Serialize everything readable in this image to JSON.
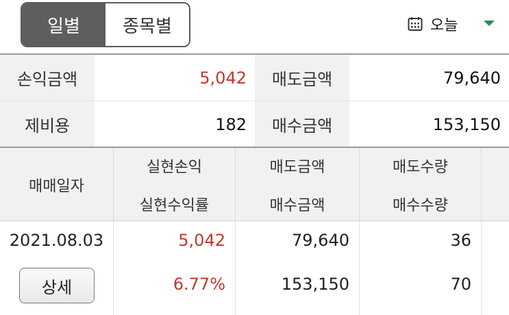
{
  "header": {
    "tabs": [
      {
        "label": "일별",
        "active": true
      },
      {
        "label": "종목별",
        "active": false
      }
    ],
    "date_selector": {
      "icon": "calendar-icon",
      "label": "오늘",
      "caret": "chevron-down-icon",
      "caret_color": "#2e8b57"
    }
  },
  "summary": {
    "profit_label": "손익금액",
    "profit_value": "5,042",
    "sell_amount_label": "매도금액",
    "sell_amount_value": "79,640",
    "fee_label": "제비용",
    "fee_value": "182",
    "buy_amount_label": "매수금액",
    "buy_amount_value": "153,150"
  },
  "table": {
    "headers": {
      "date": "매매일자",
      "realized_pl": "실현손익",
      "realized_rate": "실현수익률",
      "sell_amount": "매도금액",
      "buy_amount": "매수금액",
      "sell_qty": "매도수량",
      "buy_qty": "매수수량"
    },
    "rows": [
      {
        "date": "2021.08.03",
        "detail_button": "상세",
        "realized_pl": "5,042",
        "realized_rate": "6.77%",
        "sell_amount": "79,640",
        "buy_amount": "153,150",
        "sell_qty": "36",
        "buy_qty": "70"
      }
    ]
  },
  "colors": {
    "tab_active_bg": "#5e5e5e",
    "label_bg": "#f1f1f1",
    "profit_red": "#c0392b",
    "accent_green": "#2e8b57"
  }
}
